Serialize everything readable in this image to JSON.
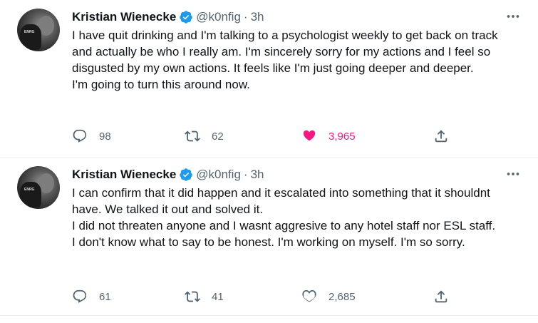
{
  "tweets": [
    {
      "author": {
        "name": "Kristian Wienecke",
        "handle": "@k0nfig",
        "avatar_text": "ENRG"
      },
      "separator": "·",
      "time": "3h",
      "text": [
        "I have quit drinking and I'm talking to a psychologist weekly to get back on track and actually be who I really am. I'm sincerely sorry for my actions and I feel so disgusted by my own actions. It feels like I'm just going deeper and deeper.",
        "I'm going to turn this around now."
      ],
      "replies": "98",
      "retweets": "62",
      "likes": "3,965",
      "liked": true
    },
    {
      "author": {
        "name": "Kristian Wienecke",
        "handle": "@k0nfig",
        "avatar_text": "ENRG"
      },
      "separator": "·",
      "time": "3h",
      "text": [
        "I can confirm that it did happen and it escalated into something that it shouldnt have. We talked it out and solved it.",
        "I did not threaten anyone and I wasnt aggresive to any hotel staff nor ESL staff.",
        "I don't know what to say to be honest. I'm working on myself. I'm so sorry."
      ],
      "replies": "61",
      "retweets": "41",
      "likes": "2,685",
      "liked": false
    }
  ],
  "colors": {
    "verified": "#1d9bf0",
    "liked": "#f91880",
    "muted": "#536471",
    "text": "#0f1419"
  },
  "icons": [
    "verified-badge-icon",
    "more-icon",
    "reply-icon",
    "retweet-icon",
    "like-icon",
    "share-icon"
  ]
}
